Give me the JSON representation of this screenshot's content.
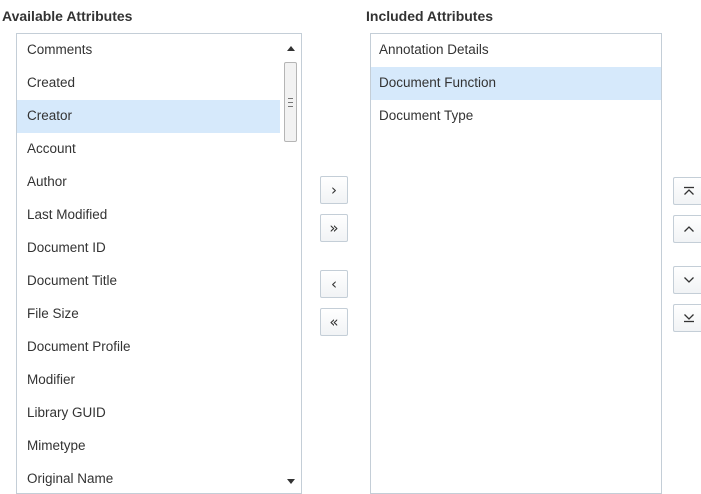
{
  "available": {
    "heading": "Available Attributes",
    "items": [
      {
        "label": "Comments",
        "selected": false
      },
      {
        "label": "Created",
        "selected": false
      },
      {
        "label": "Creator",
        "selected": true
      },
      {
        "label": "Account",
        "selected": false
      },
      {
        "label": "Author",
        "selected": false
      },
      {
        "label": "Last Modified",
        "selected": false
      },
      {
        "label": "Document ID",
        "selected": false
      },
      {
        "label": "Document Title",
        "selected": false
      },
      {
        "label": "File Size",
        "selected": false
      },
      {
        "label": "Document Profile",
        "selected": false
      },
      {
        "label": "Modifier",
        "selected": false
      },
      {
        "label": "Library GUID",
        "selected": false
      },
      {
        "label": "Mimetype",
        "selected": false
      },
      {
        "label": "Original Name",
        "selected": false
      }
    ]
  },
  "included": {
    "heading": "Included Attributes",
    "items": [
      {
        "label": "Annotation Details",
        "selected": false
      },
      {
        "label": "Document Function",
        "selected": true
      },
      {
        "label": "Document Type",
        "selected": false
      }
    ]
  },
  "transfer_buttons": {
    "move_right": "›",
    "move_all_right": "»",
    "move_left": "‹",
    "move_all_left": "«"
  },
  "icons": {
    "move_top": "move-top-icon",
    "move_up": "chevron-up-icon",
    "move_down": "chevron-down-icon",
    "move_bottom": "move-bottom-icon"
  },
  "colors": {
    "selected_row": "#d6e9fb",
    "border": "#c4ced7",
    "text": "#333333"
  }
}
